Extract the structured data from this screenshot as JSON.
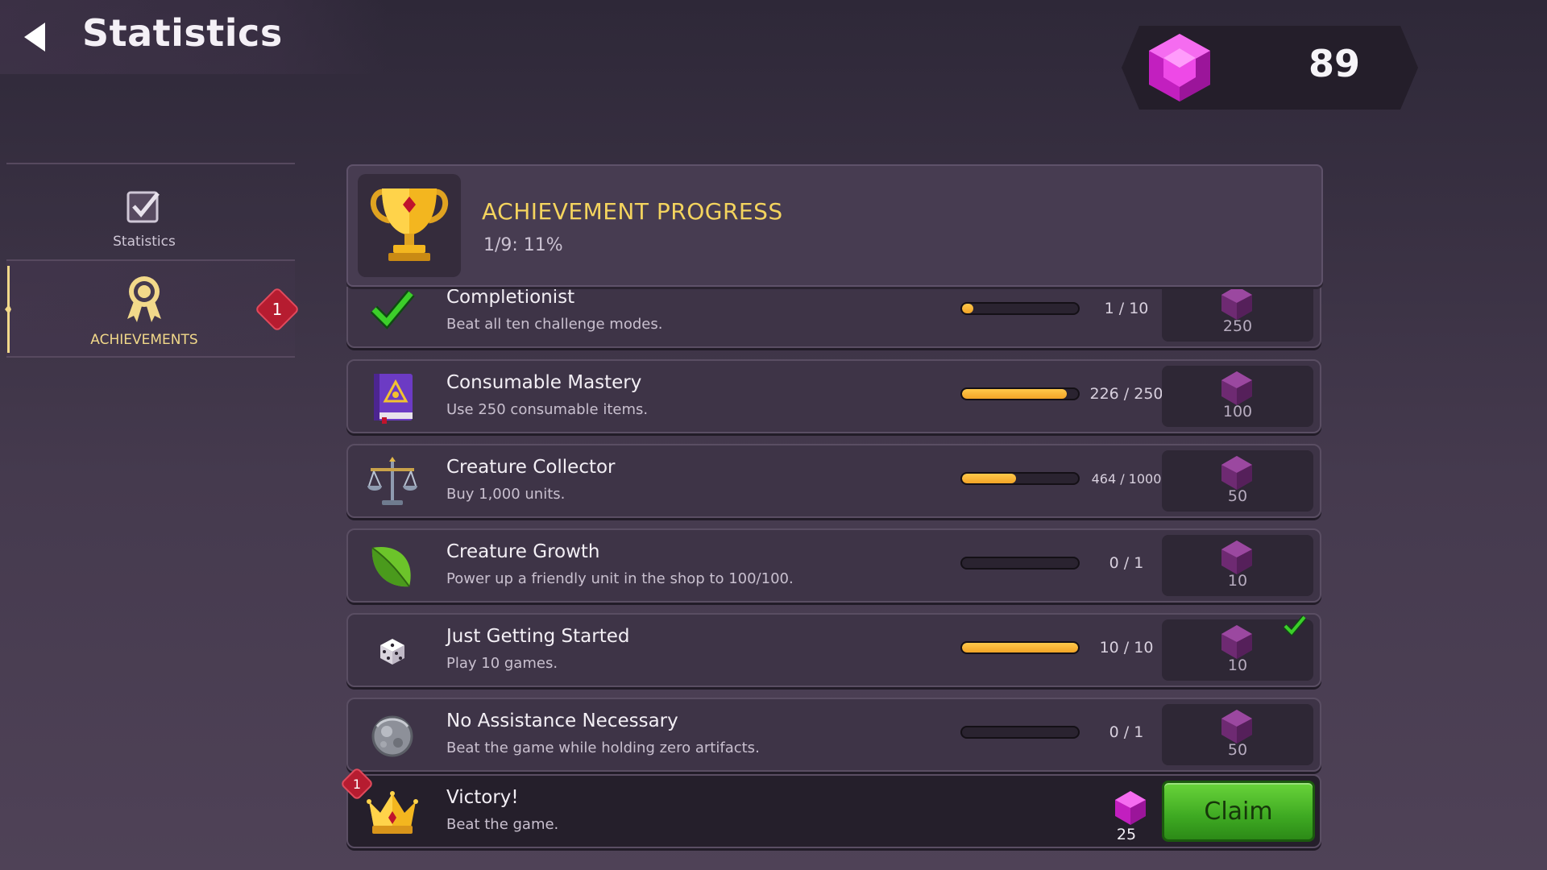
{
  "header": {
    "title": "Statistics",
    "gem_count": "89"
  },
  "sidebar": {
    "items": [
      {
        "label": "Statistics",
        "icon": "checkbox-icon",
        "active": false
      },
      {
        "label": "ACHIEVEMENTS",
        "icon": "medal-icon",
        "active": true,
        "badge": "1"
      }
    ]
  },
  "summary": {
    "title": "ACHIEVEMENT PROGRESS",
    "progress_text": "1/9: 11%",
    "completed": 1,
    "total": 9
  },
  "achievements": [
    {
      "name": "Completionist",
      "description": "Beat all ten challenge modes.",
      "progress_text": "1 / 10",
      "progress": 0.1,
      "reward": "250",
      "icon": "green-check-icon",
      "state": "in-progress"
    },
    {
      "name": "Consumable Mastery",
      "description": "Use 250 consumable items.",
      "progress_text": "226 / 250",
      "progress": 0.904,
      "reward": "100",
      "icon": "spellbook-icon",
      "state": "in-progress"
    },
    {
      "name": "Creature Collector",
      "description": "Buy 1,000 units.",
      "progress_text": "464 / 1000",
      "progress": 0.464,
      "reward": "50",
      "icon": "scales-icon",
      "state": "in-progress"
    },
    {
      "name": "Creature Growth",
      "description": "Power up a friendly unit in the shop to 100/100.",
      "progress_text": "0 / 1",
      "progress": 0,
      "reward": "10",
      "icon": "leaf-icon",
      "state": "in-progress"
    },
    {
      "name": "Just Getting Started",
      "description": "Play 10 games.",
      "progress_text": "10 / 10",
      "progress": 1,
      "reward": "10",
      "icon": "dice-icon",
      "state": "completed"
    },
    {
      "name": "No Assistance Necessary",
      "description": "Beat the game while holding zero artifacts.",
      "progress_text": "0 / 1",
      "progress": 0,
      "reward": "50",
      "icon": "orb-icon",
      "state": "in-progress"
    },
    {
      "name": "Victory!",
      "description": "Beat the game.",
      "reward": "25",
      "icon": "crown-icon",
      "state": "claimable",
      "badge": "1",
      "claim_label": "Claim"
    }
  ],
  "colors": {
    "accent_gold": "#f4d45e",
    "gem_magenta": "#e23bd9",
    "claim_green": "#3ea922",
    "badge_red": "#b61c30"
  }
}
